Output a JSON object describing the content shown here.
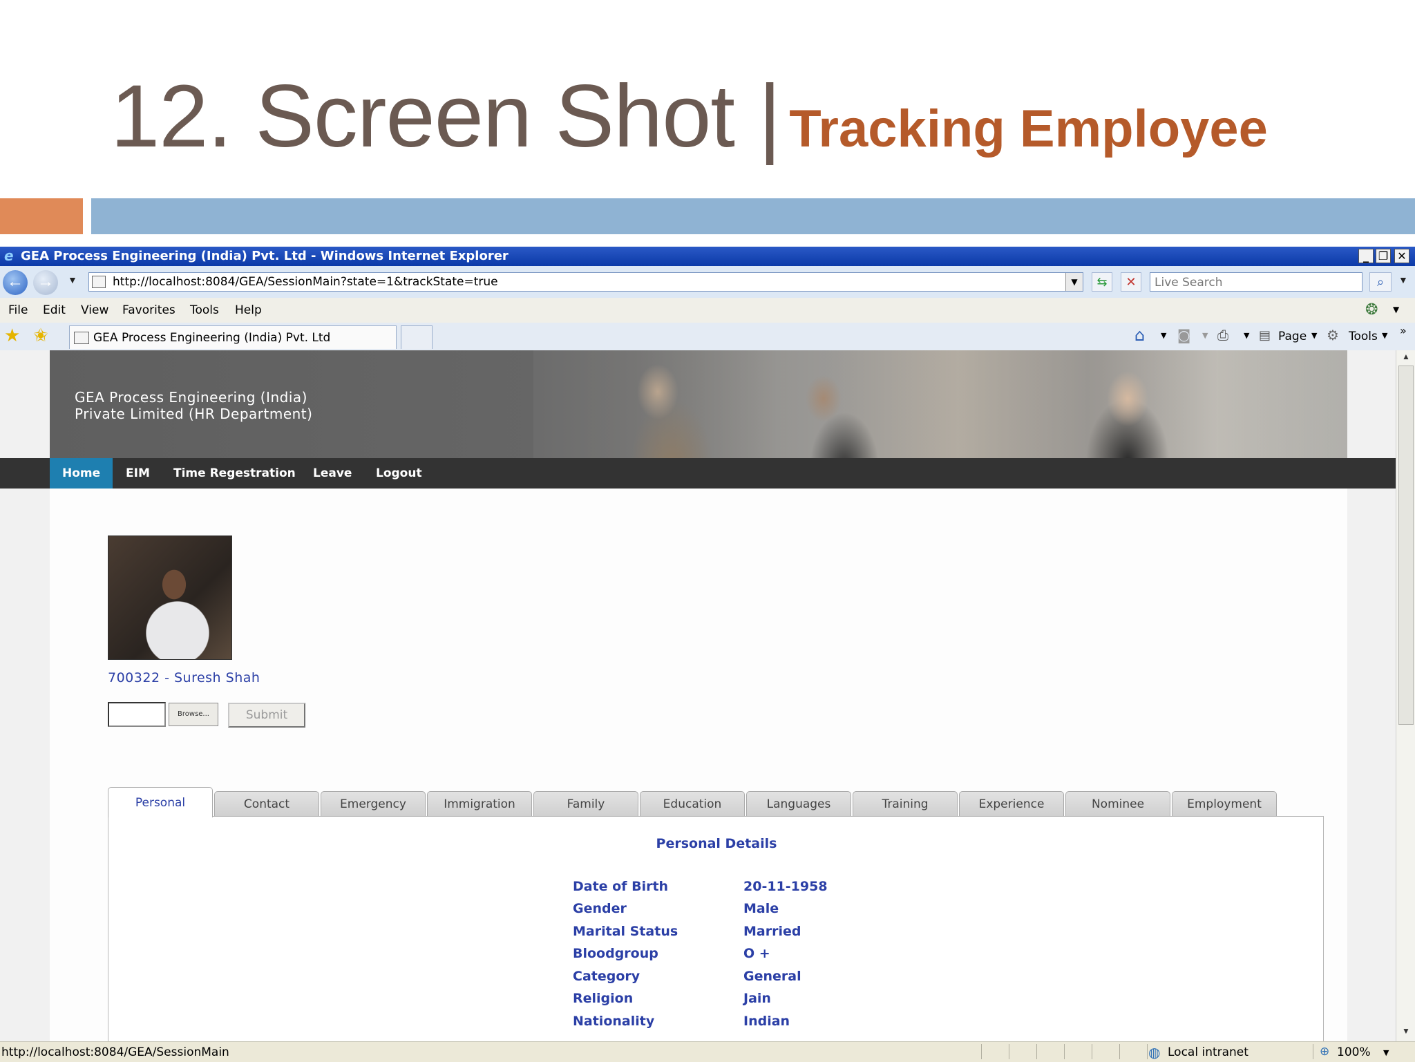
{
  "slide": {
    "title_main": "12. Screen Shot |",
    "title_accent": "Tracking Employee"
  },
  "browser": {
    "window_title": "GEA Process Engineering (India) Pvt. Ltd - Windows Internet Explorer",
    "address": "http://localhost:8084/GEA/SessionMain?state=1&trackState=true",
    "search_placeholder": "Live Search",
    "menu": [
      "File",
      "Edit",
      "View",
      "Favorites",
      "Tools",
      "Help"
    ],
    "tab_title": "GEA Process Engineering (India) Pvt. Ltd",
    "toolbar": {
      "page": "Page",
      "tools": "Tools"
    },
    "status_url": "http://localhost:8084/GEA/SessionMain",
    "status_zone": "Local intranet",
    "zoom": "100%"
  },
  "site": {
    "company_line1": "GEA Process Engineering (India)",
    "company_line2": "Private Limited (HR Department)",
    "nav": [
      "Home",
      "EIM",
      "Time Regestration",
      "Leave",
      "Logout"
    ],
    "active_nav": "Home"
  },
  "employee": {
    "id_name": "700322 - Suresh Shah",
    "browse_label": "Browse...",
    "submit_label": "Submit"
  },
  "tabs": [
    "Personal",
    "Contact",
    "Emergency",
    "Immigration",
    "Family",
    "Education",
    "Languages",
    "Training",
    "Experience",
    "Nominee",
    "Employment"
  ],
  "active_tab": "Personal",
  "personal": {
    "heading": "Personal Details",
    "rows": [
      {
        "label": "Date of Birth",
        "value": "20-11-1958"
      },
      {
        "label": "Gender",
        "value": "Male"
      },
      {
        "label": "Marital Status",
        "value": "Married"
      },
      {
        "label": "Bloodgroup",
        "value": "O +"
      },
      {
        "label": "Category",
        "value": "General"
      },
      {
        "label": "Religion",
        "value": "Jain"
      },
      {
        "label": "Nationality",
        "value": "Indian"
      }
    ]
  },
  "colors": {
    "title_grey": "#6b5a52",
    "title_accent": "#b55a2a",
    "bar_orange": "#e08a58",
    "bar_blue": "#8fb3d3",
    "nav_active": "#1e7fb0",
    "text_blue": "#2b3fa6"
  },
  "icons": [
    "ie-logo-icon",
    "back-arrow-icon",
    "forward-arrow-icon",
    "refresh-icon",
    "stop-icon",
    "search-icon",
    "favorites-star-icon",
    "add-favorites-icon",
    "home-icon",
    "feeds-icon",
    "print-icon",
    "page-icon",
    "tools-gear-icon",
    "globe-icon"
  ]
}
